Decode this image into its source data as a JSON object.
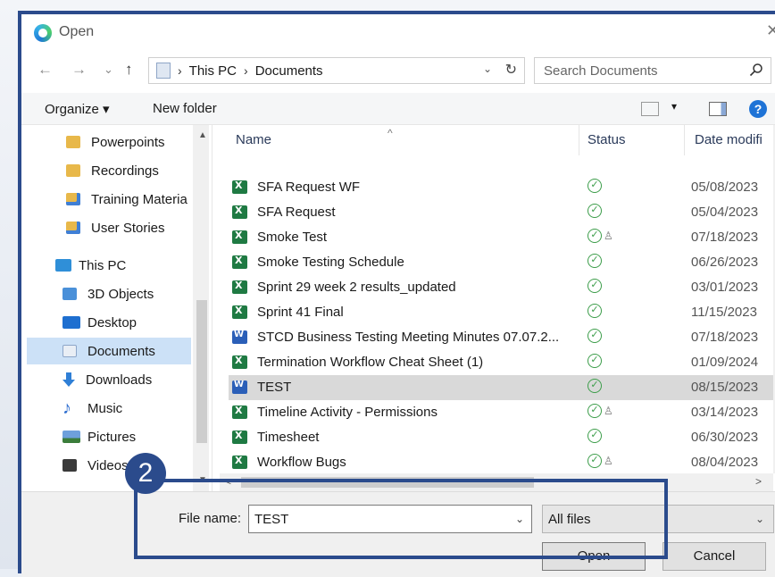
{
  "window": {
    "title": "Open",
    "close": "✕"
  },
  "nav": {
    "back": "←",
    "forward": "→",
    "recent": "⌄",
    "up": "↑",
    "breadcrumb": [
      "This PC",
      "Documents"
    ],
    "dropdown": "⌄",
    "refresh": "↻",
    "search_placeholder": "Search Documents"
  },
  "toolbar": {
    "organize": "Organize ▾",
    "new_folder": "New folder",
    "help": "?",
    "view_dd": "▾"
  },
  "sidebar": {
    "items": [
      {
        "label": "Powerpoints",
        "icon": "folder-icon"
      },
      {
        "label": "Recordings",
        "icon": "folder-icon"
      },
      {
        "label": "Training Materia",
        "icon": "folder-icon"
      },
      {
        "label": "User Stories",
        "icon": "folder-icon"
      },
      {
        "label": "This PC",
        "icon": "computer-icon"
      },
      {
        "label": "3D Objects",
        "icon": "3d-objects-icon"
      },
      {
        "label": "Desktop",
        "icon": "desktop-icon"
      },
      {
        "label": "Documents",
        "icon": "documents-icon"
      },
      {
        "label": "Downloads",
        "icon": "downloads-icon"
      },
      {
        "label": "Music",
        "icon": "music-icon"
      },
      {
        "label": "Pictures",
        "icon": "pictures-icon"
      },
      {
        "label": "Videos",
        "icon": "videos-icon"
      }
    ],
    "selected": "Documents",
    "scroll_up": "▲",
    "scroll_down": "▼"
  },
  "columns": {
    "name": "Name",
    "status": "Status",
    "date": "Date modifi",
    "sort_caret": "^"
  },
  "files": [
    {
      "name": "SFA Request WF",
      "type": "excel",
      "status": "✓",
      "shared": "",
      "date": "05/08/2023"
    },
    {
      "name": "SFA Request",
      "type": "excel",
      "status": "✓",
      "shared": "",
      "date": "05/04/2023"
    },
    {
      "name": "Smoke Test",
      "type": "excel",
      "status": "✓",
      "shared": "♙",
      "date": "07/18/2023"
    },
    {
      "name": "Smoke Testing Schedule",
      "type": "excel",
      "status": "✓",
      "shared": "",
      "date": "06/26/2023"
    },
    {
      "name": "Sprint 29 week 2 results_updated",
      "type": "excel",
      "status": "✓",
      "shared": "",
      "date": "03/01/2023"
    },
    {
      "name": "Sprint 41 Final",
      "type": "excel",
      "status": "✓",
      "shared": "",
      "date": "11/15/2023"
    },
    {
      "name": "STCD Business Testing Meeting Minutes 07.07.2...",
      "type": "word",
      "status": "✓",
      "shared": "",
      "date": "07/18/2023"
    },
    {
      "name": "Termination Workflow Cheat Sheet (1)",
      "type": "excel",
      "status": "✓",
      "shared": "",
      "date": "01/09/2024"
    },
    {
      "name": "TEST",
      "type": "word",
      "status": "✓",
      "shared": "",
      "date": "08/15/2023"
    },
    {
      "name": "Timeline Activity -  Permissions",
      "type": "excel",
      "status": "✓",
      "shared": "♙",
      "date": "03/14/2023"
    },
    {
      "name": "Timesheet",
      "type": "excel",
      "status": "✓",
      "shared": "",
      "date": "06/30/2023"
    },
    {
      "name": "Workflow Bugs",
      "type": "excel",
      "status": "✓",
      "shared": "♙",
      "date": "08/04/2023"
    }
  ],
  "selected_file": "TEST",
  "list_scroll": {
    "left": "<",
    "right": ">"
  },
  "footer": {
    "file_name_label": "File name:",
    "file_name_value": "TEST",
    "file_name_dd": "⌄",
    "file_type": "All files",
    "file_type_dd": "⌄",
    "open_label": "Open",
    "cancel_label": "Cancel"
  },
  "annotation": {
    "step": "2",
    "color": "#2b4b8c"
  },
  "colors": {
    "selection": "#cce1f7",
    "selected_row": "#d9d9d9",
    "status_ok": "#3c9d4a",
    "accent": "#2b4b8c"
  }
}
